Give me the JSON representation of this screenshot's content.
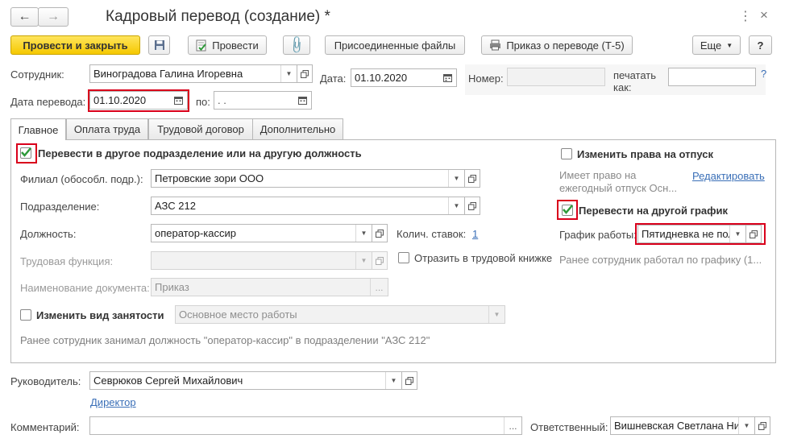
{
  "window": {
    "title": "Кадровый перевод (создание) *"
  },
  "toolbar": {
    "post_close": "Провести и закрыть",
    "post": "Провести",
    "attached_files": "Присоединенные файлы",
    "order": "Приказ о переводе (Т-5)",
    "more": "Еще",
    "help": "?"
  },
  "header": {
    "employee_label": "Сотрудник:",
    "employee": "Виноградова Галина Игоревна",
    "date_label": "Дата:",
    "date": "01.10.2020",
    "number_label": "Номер:",
    "number": "",
    "print_as_label_1": "печатать",
    "print_as_label_2": "как:",
    "print_as": "",
    "transfer_date_label": "Дата перевода:",
    "transfer_date": "01.10.2020",
    "to_label": "по:",
    "to_date": " .  .",
    "help_mark": "?"
  },
  "tabs": [
    "Главное",
    "Оплата труда",
    "Трудовой договор",
    "Дополнительно"
  ],
  "main": {
    "transfer_check": "Перевести в другое подразделение или на другую должность",
    "branch_label": "Филиал (обособл. подр.):",
    "branch": "Петровские зори ООО",
    "dept_label": "Подразделение:",
    "dept": "АЗС 212",
    "position_label": "Должность:",
    "position": "оператор-кассир",
    "rates_label": "Колич. ставок:",
    "rates": "1",
    "function_label": "Трудовая функция:",
    "function": "",
    "workbook_check": "Отразить в трудовой книжке",
    "docname_label": "Наименование документа:",
    "docname": "Приказ",
    "employment_check": "Изменить вид занятости",
    "employment": "Основное место работы",
    "previous_note": "Ранее сотрудник занимал должность \"оператор-кассир\" в подразделении \"АЗС 212\"",
    "vacation_check": "Изменить права на отпуск",
    "vacation_note_1": "Имеет право на",
    "vacation_note_2": "ежегодный отпуск Осн...",
    "edit_link": "Редактировать",
    "schedule_check": "Перевести на другой график",
    "schedule_label": "График работы:",
    "schedule": "Пятидневка не пол",
    "schedule_note": "Ранее сотрудник работал по графику (1..."
  },
  "footer": {
    "manager_label": "Руководитель:",
    "manager": "Севрюков Сергей Михайлович",
    "manager_position": "Директор",
    "comment_label": "Комментарий:",
    "comment": "",
    "responsible_label": "Ответственный:",
    "responsible": "Вишневская Светлана Ни"
  }
}
